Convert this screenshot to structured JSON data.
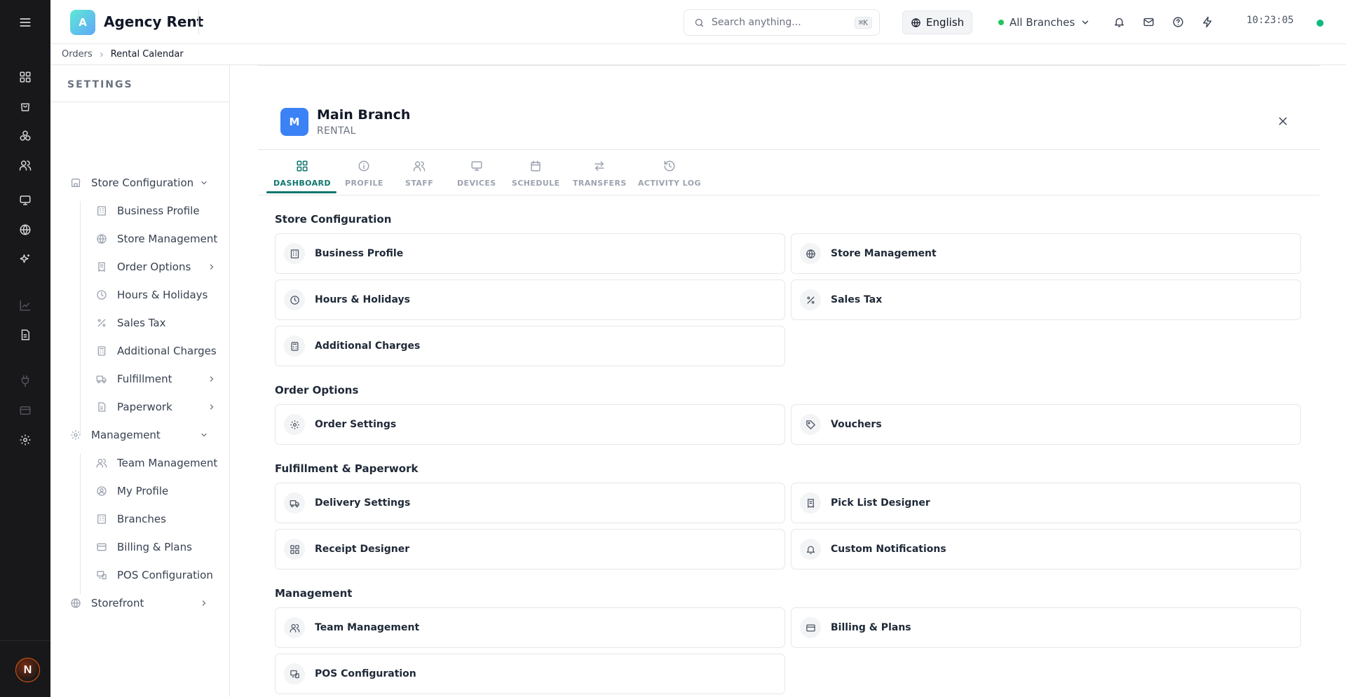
{
  "app": {
    "logo_letter": "A",
    "name": "Agency Rent"
  },
  "search": {
    "placeholder": "Search anything...",
    "shortcut": "⌘K"
  },
  "language": {
    "label": "English"
  },
  "branch_selector": {
    "label": "All Branches"
  },
  "clock": {
    "time": "10:23:05"
  },
  "user": {
    "avatar_letter": "N"
  },
  "breadcrumb": {
    "items": [
      "Orders",
      "Rental Calendar"
    ]
  },
  "settings": {
    "title": "SETTINGS",
    "groups": [
      {
        "label": "Store Configuration",
        "items": [
          "Business Profile",
          "Store Management",
          "Order Options",
          "Hours & Holidays",
          "Sales Tax",
          "Additional Charges",
          "Fulfillment",
          "Paperwork"
        ]
      },
      {
        "label": "Management",
        "items": [
          "Team Management",
          "My Profile",
          "Branches",
          "Billing & Plans",
          "POS Configuration"
        ]
      },
      {
        "label": "Storefront"
      }
    ]
  },
  "panel": {
    "avatar_letter": "M",
    "title": "Main Branch",
    "subtitle": "RENTAL",
    "tabs": [
      "DASHBOARD",
      "PROFILE",
      "STAFF",
      "DEVICES",
      "SCHEDULE",
      "TRANSFERS",
      "ACTIVITY LOG"
    ],
    "active_tab": "DASHBOARD",
    "sections": [
      {
        "title": "Store Configuration",
        "cards": [
          "Business Profile",
          "Store Management",
          "Hours & Holidays",
          "Sales Tax",
          "Additional Charges"
        ]
      },
      {
        "title": "Order Options",
        "cards": [
          "Order Settings",
          "Vouchers"
        ]
      },
      {
        "title": "Fulfillment & Paperwork",
        "cards": [
          "Delivery Settings",
          "Pick List Designer",
          "Receipt Designer",
          "Custom Notifications"
        ]
      },
      {
        "title": "Management",
        "cards": [
          "Team Management",
          "Billing & Plans",
          "POS Configuration"
        ]
      }
    ]
  },
  "colors": {
    "accent": "#0f766e",
    "online": "#10b981",
    "rail_bg": "#18181b",
    "branch_avatar": "#3b82f6"
  }
}
